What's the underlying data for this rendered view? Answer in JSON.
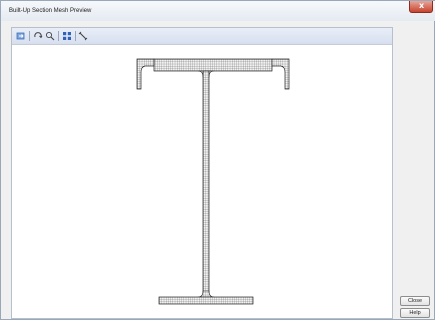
{
  "window": {
    "title": "Built-Up Section Mesh Preview",
    "close_glyph": "x"
  },
  "toolbar": {
    "icons": [
      "pan-icon",
      "rotate-icon",
      "zoom-window-icon",
      "fit-icon",
      "measure-icon"
    ]
  },
  "buttons": {
    "close_label": "Close",
    "help_label": "Help"
  },
  "colors": {
    "mesh_fill": "#f2f2f2",
    "mesh_line": "#333333",
    "close_button": "#c6442f"
  }
}
